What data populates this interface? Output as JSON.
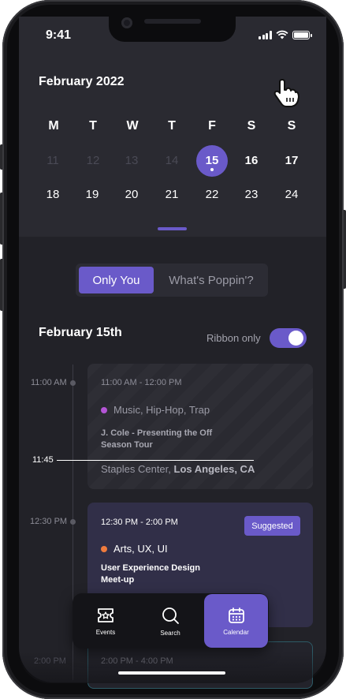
{
  "status_bar": {
    "time": "9:41"
  },
  "calendar": {
    "month_title": "February 2022",
    "weekdays": [
      "M",
      "T",
      "W",
      "T",
      "F",
      "S",
      "S"
    ],
    "week1": [
      "11",
      "12",
      "13",
      "14",
      "15",
      "16",
      "17"
    ],
    "week2": [
      "18",
      "19",
      "20",
      "21",
      "22",
      "23",
      "24"
    ],
    "selected_day": "15"
  },
  "segment": {
    "active_label": "Only You",
    "inactive_label": "What's Poppin'?"
  },
  "schedule": {
    "date_heading": "February 15th",
    "ribbon_label": "Ribbon only",
    "ribbon_on": true,
    "now_label": "11:45",
    "time_labels": [
      "11:00 AM",
      "12:30 PM",
      "2:00 PM"
    ]
  },
  "events": [
    {
      "time_range": "11:00 AM - 12:00 PM",
      "tags": "Music, Hip-Hop, Trap",
      "tag_color": "#b455d6",
      "title": "J. Cole - Presenting the Off Season Tour",
      "venue": "Staples Center,",
      "city": "Los Angeles, CA"
    },
    {
      "time_range": "12:30 PM - 2:00 PM",
      "badge": "Suggested",
      "tags": "Arts, UX, UI",
      "tag_color": "#ef7b3d",
      "title": "User Experience Design Meet-up"
    },
    {
      "time_range": "2:00 PM - 4:00 PM"
    }
  ],
  "bottom_nav": {
    "events_label": "Events",
    "search_label": "Search",
    "calendar_label": "Calendar"
  },
  "colors": {
    "accent": "#6a5ac9",
    "background": "#222228",
    "panel": "#2a2a31"
  }
}
